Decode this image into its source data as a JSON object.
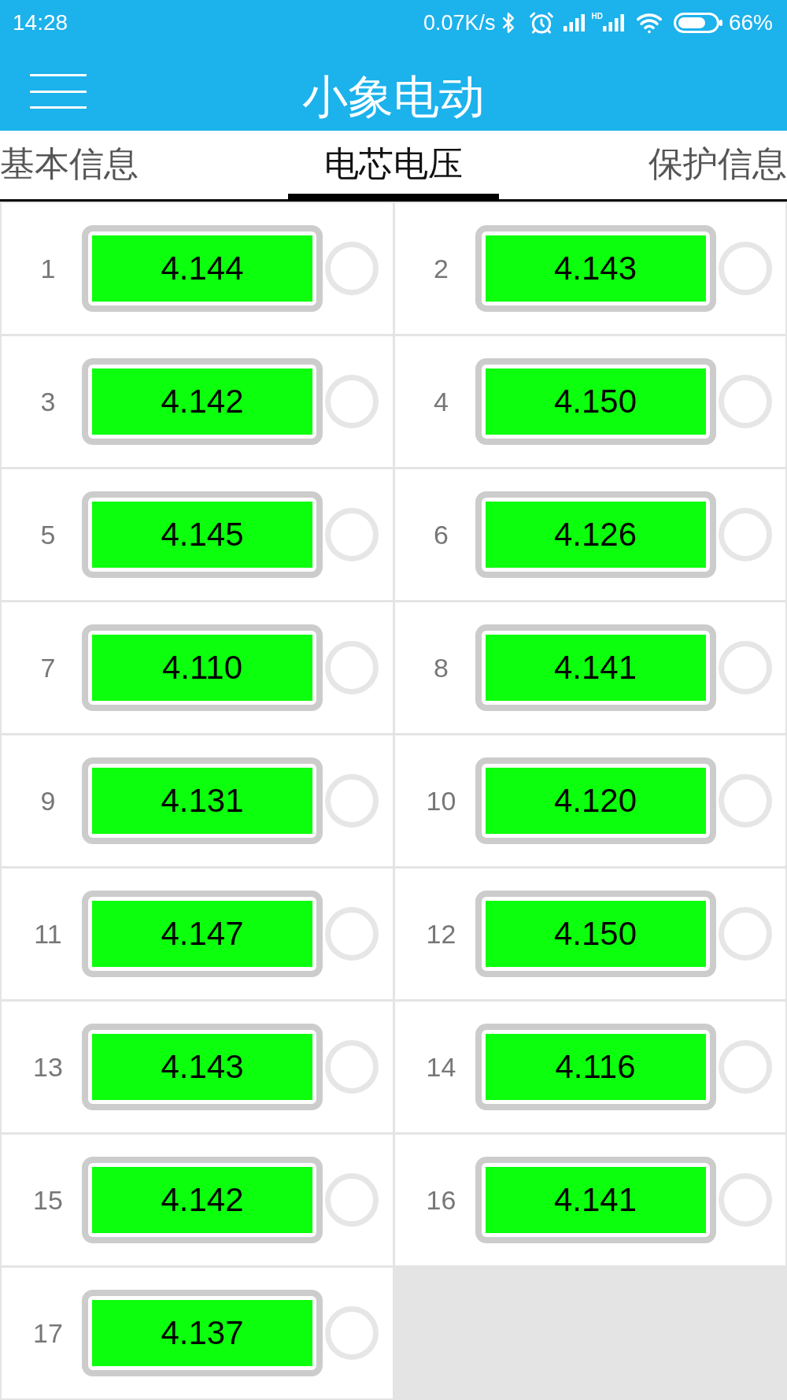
{
  "status_bar": {
    "time": "14:28",
    "net_speed": "0.07K/s",
    "network_label": "HD",
    "battery": "66%"
  },
  "toolbar": {
    "title": "小象电动"
  },
  "tabs": [
    {
      "label": "基本信息",
      "selected": false
    },
    {
      "label": "电芯电压",
      "selected": true
    },
    {
      "label": "保护信息",
      "selected": false
    }
  ],
  "cells": [
    {
      "number": "1",
      "voltage": "4.144"
    },
    {
      "number": "2",
      "voltage": "4.143"
    },
    {
      "number": "3",
      "voltage": "4.142"
    },
    {
      "number": "4",
      "voltage": "4.150"
    },
    {
      "number": "5",
      "voltage": "4.145"
    },
    {
      "number": "6",
      "voltage": "4.126"
    },
    {
      "number": "7",
      "voltage": "4.110"
    },
    {
      "number": "8",
      "voltage": "4.141"
    },
    {
      "number": "9",
      "voltage": "4.131"
    },
    {
      "number": "10",
      "voltage": "4.120"
    },
    {
      "number": "11",
      "voltage": "4.147"
    },
    {
      "number": "12",
      "voltage": "4.150"
    },
    {
      "number": "13",
      "voltage": "4.143"
    },
    {
      "number": "14",
      "voltage": "4.116"
    },
    {
      "number": "15",
      "voltage": "4.142"
    },
    {
      "number": "16",
      "voltage": "4.141"
    },
    {
      "number": "17",
      "voltage": "4.137"
    }
  ]
}
